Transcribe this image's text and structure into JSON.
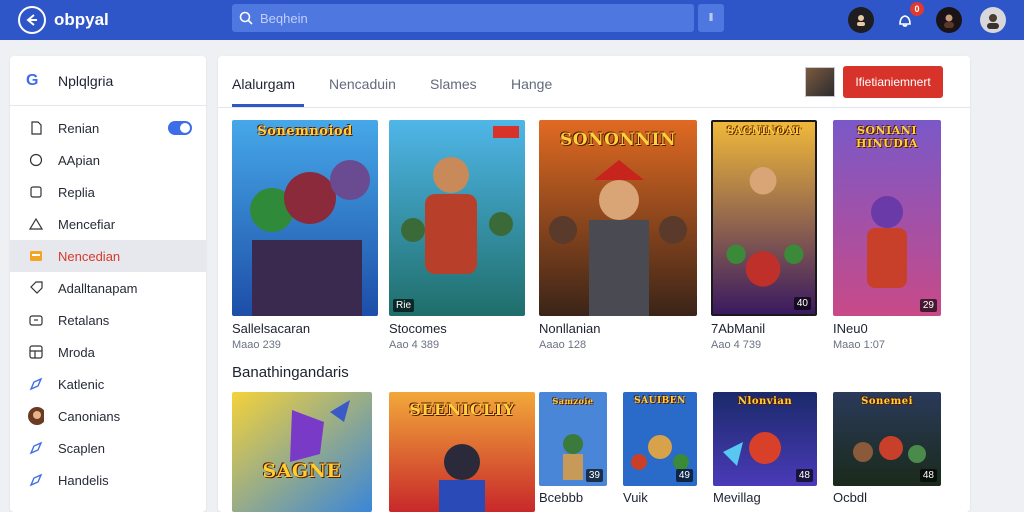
{
  "app": {
    "name": "obpyal"
  },
  "search": {
    "placeholder": "Beqhein"
  },
  "notifications": {
    "count": "0"
  },
  "sidebar": {
    "title": "Nplqlgria",
    "items": [
      {
        "label": "Renian",
        "icon": "doc-icon"
      },
      {
        "label": "AApian",
        "icon": "circle-icon"
      },
      {
        "label": "Replia",
        "icon": "square-icon"
      },
      {
        "label": "Mencefiar",
        "icon": "triangle-icon"
      },
      {
        "label": "Nencedian",
        "icon": "folder-icon",
        "active": true
      },
      {
        "label": "Adalltanapam",
        "icon": "tag-icon"
      },
      {
        "label": "Retalans",
        "icon": "box-icon"
      },
      {
        "label": "Mroda",
        "icon": "grid-icon"
      },
      {
        "label": "Katlenic",
        "icon": "compass-icon"
      },
      {
        "label": "Canonians",
        "icon": "avatar-icon"
      },
      {
        "label": "Scaplen",
        "icon": "compass-icon"
      },
      {
        "label": "Handelis",
        "icon": "compass-icon"
      }
    ]
  },
  "tabs": [
    {
      "label": "Alalurgam",
      "active": true
    },
    {
      "label": "Nencaduin"
    },
    {
      "label": "Slames"
    },
    {
      "label": "Hange"
    }
  ],
  "cta": {
    "label": "Ifietianiemnert"
  },
  "games_top": [
    {
      "name": "Sallelsacaran",
      "meta": "Maao 239",
      "cover_title": "Sonemnoiod"
    },
    {
      "name": "Stocomes",
      "meta": "Aao 4 389",
      "cover_title": "",
      "corner": "Rie"
    },
    {
      "name": "Nonllanian",
      "meta": "Aaao 128",
      "cover_title": "SONONNIN"
    },
    {
      "name": "7AbManil",
      "meta": "Aao 4 739",
      "cover_title": "SAGNINOAT",
      "corner": "40"
    },
    {
      "name": "INeu0",
      "meta": "Maao 1:07",
      "cover_title": "SONIANI HINUDIA",
      "corner": "29"
    }
  ],
  "section": {
    "title": "Banathingandaris"
  },
  "games_bottom": [
    {
      "name": "",
      "meta": "",
      "cover_title": "SAGNE"
    },
    {
      "name": "",
      "meta": "",
      "cover_title": "SEENICLIY"
    },
    {
      "name": "Bcebbb",
      "meta": "",
      "cover_title": "Samzoie",
      "corner": "39"
    },
    {
      "name": "Vuik",
      "meta": "",
      "cover_title": "SAUIBEN",
      "corner": "49"
    },
    {
      "name": "Mevillag",
      "meta": "",
      "cover_title": "Nlonvian",
      "corner": "48"
    },
    {
      "name": "Ocbdl",
      "meta": "",
      "cover_title": "Sonemei",
      "corner": "48"
    }
  ],
  "colors": {
    "topbar": "#2f56c8",
    "accent": "#d8332a",
    "active_text": "#d63a2a"
  }
}
